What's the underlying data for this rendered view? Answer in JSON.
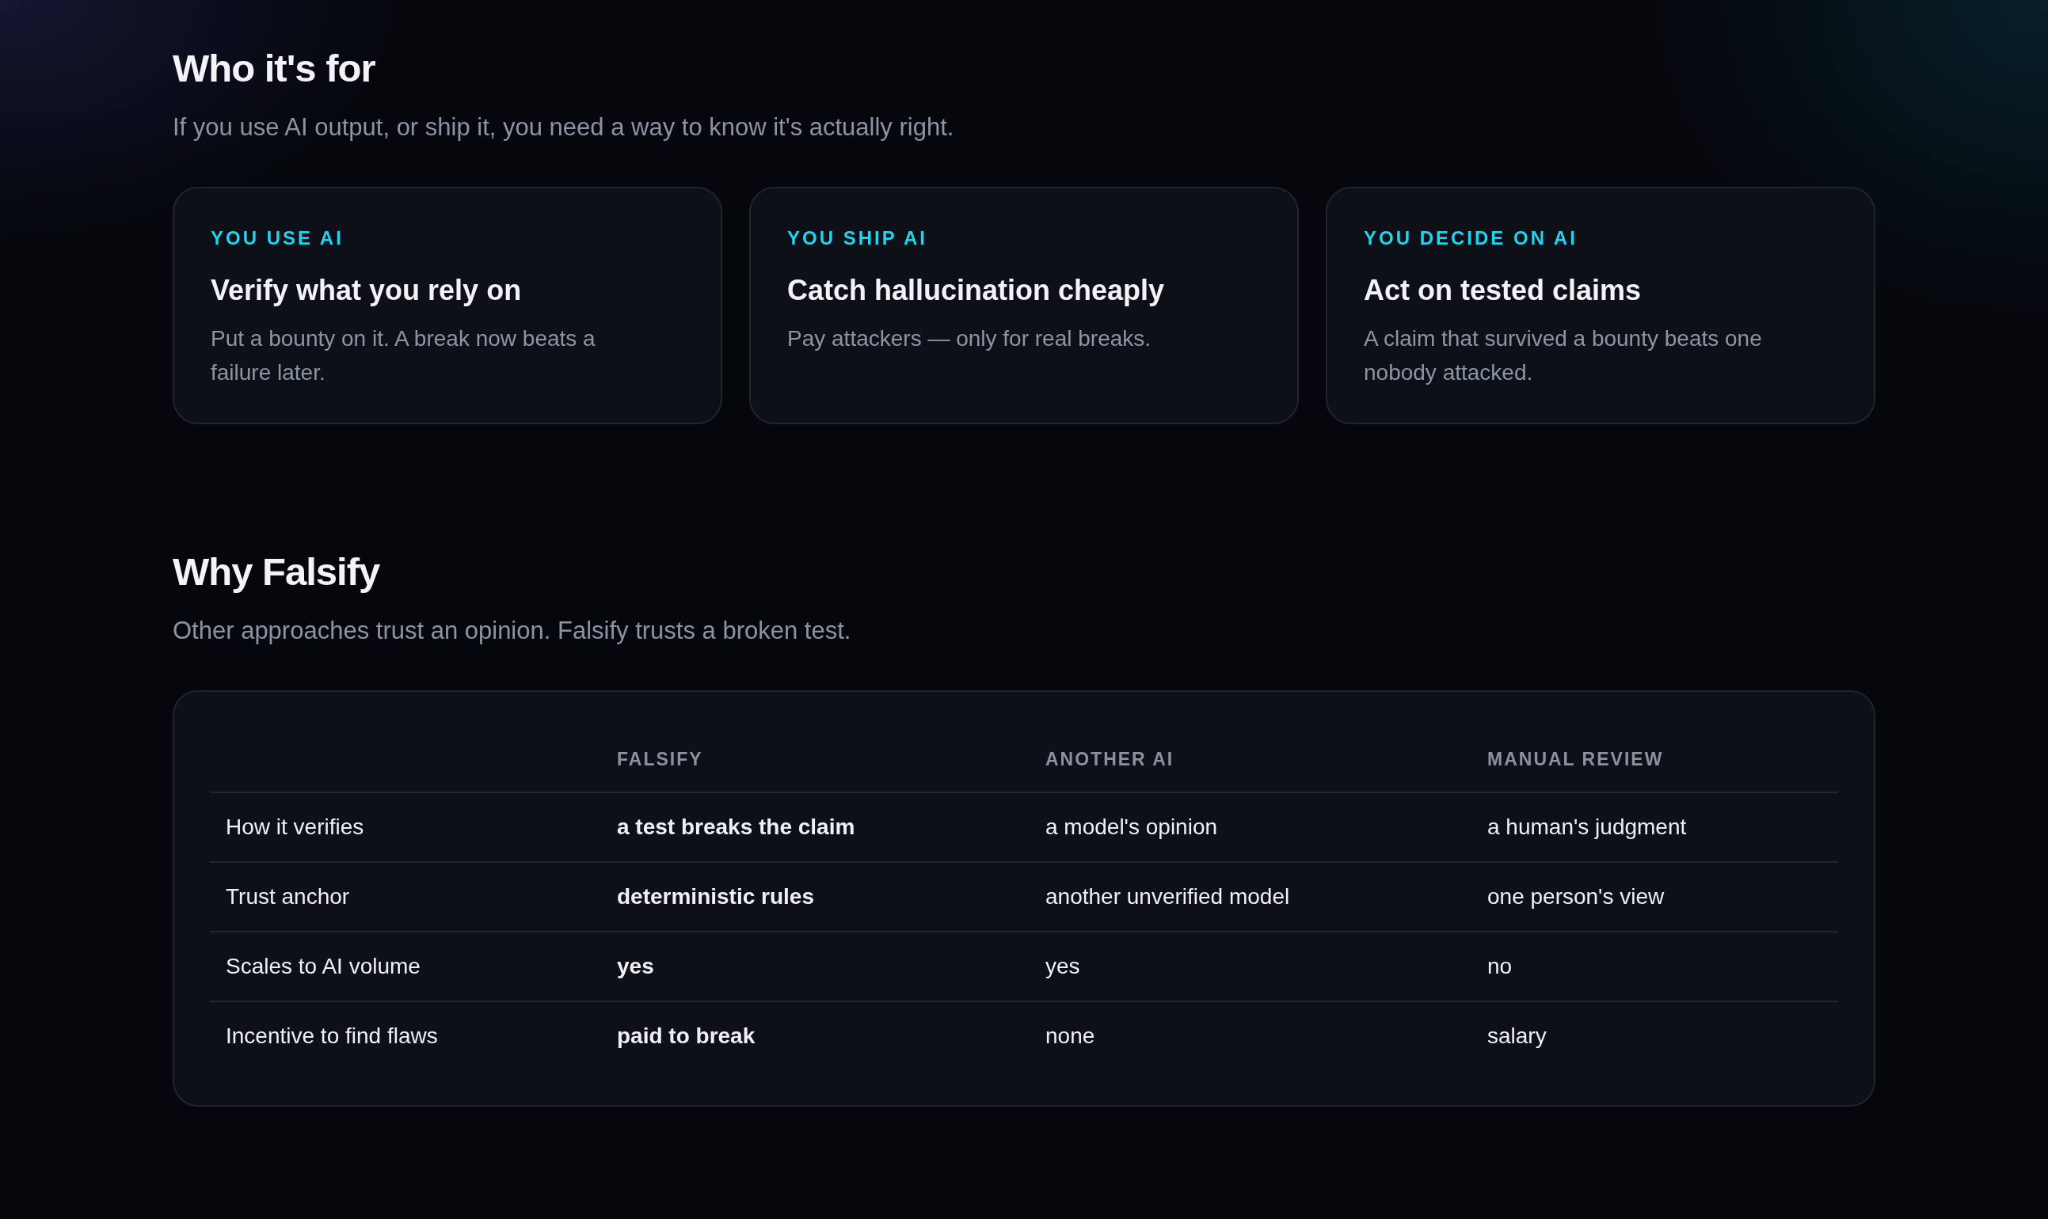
{
  "sections": [
    {
      "title": "Who it's for",
      "subtitle": "If you use AI output, or ship it, you need a way to know it's actually right.",
      "cards": [
        {
          "eyebrow": "YOU USE AI",
          "title": "Verify what you rely on",
          "body": "Put a bounty on it. A break now beats a failure later."
        },
        {
          "eyebrow": "YOU SHIP AI",
          "title": "Catch hallucination cheaply",
          "body": "Pay attackers — only for real breaks."
        },
        {
          "eyebrow": "YOU DECIDE ON AI",
          "title": "Act on tested claims",
          "body": "A claim that survived a bounty beats one nobody attacked."
        }
      ]
    },
    {
      "title": "Why Falsify",
      "subtitle": "Other approaches trust an opinion. Falsify trusts a broken test.",
      "table": {
        "columns": [
          {
            "emphasized": false
          },
          {
            "label": "FALSIFY",
            "emphasized": true
          },
          {
            "label": "ANOTHER AI",
            "emphasized": false
          },
          {
            "label": "MANUAL REVIEW",
            "emphasized": false
          }
        ],
        "rows": [
          [
            "How it verifies",
            "a test breaks the claim",
            "a model's opinion",
            "a human's judgment"
          ],
          [
            "Trust anchor",
            "deterministic rules",
            "another unverified model",
            "one person's view"
          ],
          [
            "Scales to AI volume",
            "yes",
            "yes",
            "no"
          ],
          [
            "Incentive to find flaws",
            "paid to break",
            "none",
            "salary"
          ]
        ]
      }
    }
  ]
}
